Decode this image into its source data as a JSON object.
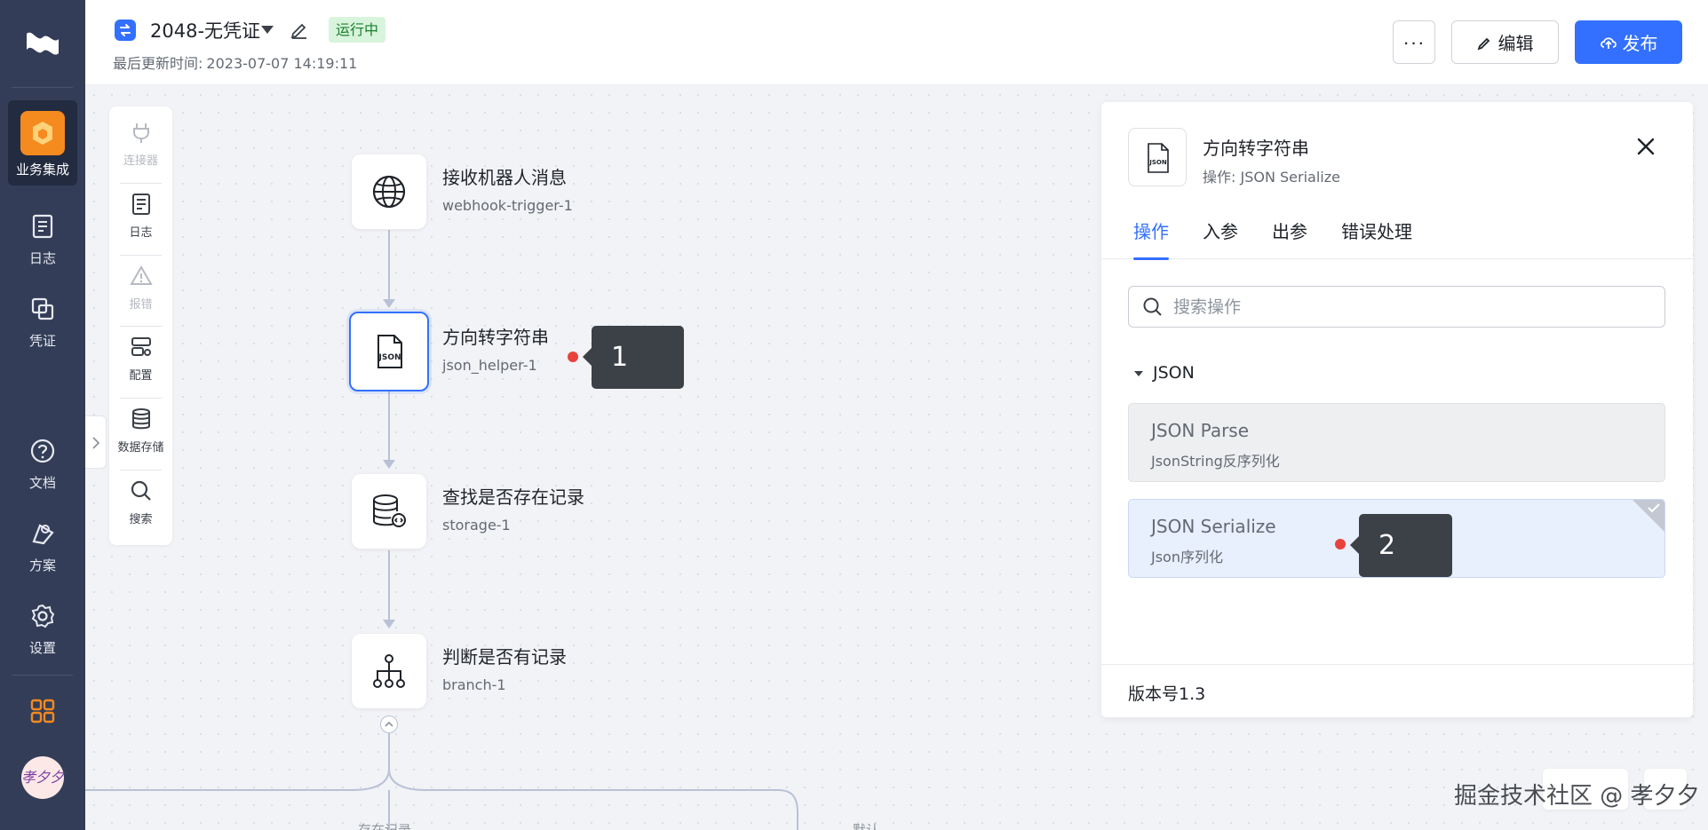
{
  "header": {
    "title": "2048-无凭证",
    "status": "运行中",
    "updated_label": "最后更新时间:",
    "updated_value": "2023-07-07 14:19:11",
    "more_label": "···",
    "edit_label": "编辑",
    "publish_label": "发布"
  },
  "rail": {
    "items": [
      {
        "label": "业务集成",
        "icon": "integration-icon",
        "active": true
      },
      {
        "label": "日志",
        "icon": "log-icon"
      },
      {
        "label": "凭证",
        "icon": "credential-icon"
      },
      {
        "label": "文档",
        "icon": "help-icon"
      },
      {
        "label": "方案",
        "icon": "solution-icon"
      },
      {
        "label": "设置",
        "icon": "gear-icon"
      }
    ],
    "avatar_text": "孝夕夕"
  },
  "toolbar": {
    "items": [
      {
        "label": "连接器",
        "icon": "plug-icon",
        "disabled": true
      },
      {
        "label": "日志",
        "icon": "log-icon"
      },
      {
        "label": "报错",
        "icon": "warning-icon",
        "disabled": true
      },
      {
        "label": "配置",
        "icon": "config-icon"
      },
      {
        "label": "数据存储",
        "icon": "database-icon"
      },
      {
        "label": "搜索",
        "icon": "search-icon"
      }
    ]
  },
  "flow": {
    "nodes": [
      {
        "name": "接收机器人消息",
        "id": "webhook-trigger-1",
        "icon": "globe-icon"
      },
      {
        "name": "方向转字符串",
        "id": "json_helper-1",
        "icon": "json-file-icon",
        "selected": true
      },
      {
        "name": "查找是否存在记录",
        "id": "storage-1",
        "icon": "database-search-icon"
      },
      {
        "name": "判断是否有记录",
        "id": "branch-1",
        "icon": "branch-icon"
      }
    ],
    "branch_labels": [
      "存在记录",
      "默认"
    ]
  },
  "markers": [
    "1",
    "2"
  ],
  "panel": {
    "title": "方向转字符串",
    "subtitle": "操作: JSON Serialize",
    "tabs": [
      "操作",
      "入参",
      "出参",
      "错误处理"
    ],
    "active_tab": 0,
    "search_placeholder": "搜索操作",
    "group": "JSON",
    "operations": [
      {
        "name": "JSON Parse",
        "desc": "JsonString反序列化"
      },
      {
        "name": "JSON Serialize",
        "desc": "Json序列化",
        "selected": true
      }
    ],
    "version": "版本号1.3"
  },
  "watermark": "掘金技术社区 @ 孝夕夕",
  "colors": {
    "primary": "#3370ff",
    "rail_bg": "#333d57",
    "accent_orange": "#f58a1f",
    "status_green": "#1a7f2e",
    "marker_red": "#e8423c"
  }
}
